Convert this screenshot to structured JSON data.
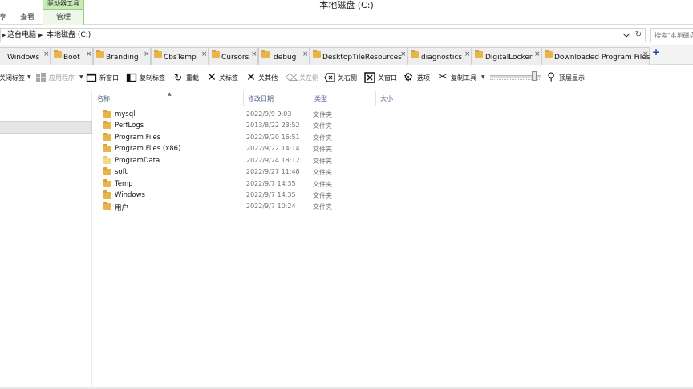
{
  "window": {
    "title": "本地磁盘 (C:)"
  },
  "ribbon": {
    "context_group": "驱动器工具",
    "tabs": [
      {
        "label": "享"
      },
      {
        "label": "查看"
      },
      {
        "label": "管理"
      }
    ]
  },
  "address": {
    "crumbs": [
      "这台电脑",
      "本地磁盘 (C:)"
    ],
    "search_placeholder": "搜索\"本地磁盘"
  },
  "folder_tabs": [
    {
      "label": "Windows"
    },
    {
      "label": "Boot"
    },
    {
      "label": "Branding"
    },
    {
      "label": "CbsTemp"
    },
    {
      "label": "Cursors"
    },
    {
      "label": "debug"
    },
    {
      "label": "DesktopTileResources"
    },
    {
      "label": "diagnostics"
    },
    {
      "label": "DigitalLocker"
    },
    {
      "label": "Downloaded Program Files"
    }
  ],
  "new_tab_symbol": "+",
  "close_symbol": "×",
  "toolbar": {
    "close_tabs": "关闭标签",
    "apps": "应用程序",
    "new_window": "新窗口",
    "copy_tab": "复制标签",
    "reload": "重载",
    "close_tab": "关标签",
    "close_others": "关其他",
    "close_left": "关左侧",
    "close_right": "关右侧",
    "close_window": "关窗口",
    "options": "选项",
    "copy_tools": "复制工具",
    "top_most": "顶层显示",
    "opacity_level": 0.9
  },
  "columns": {
    "name": "名称",
    "modified": "修改日期",
    "type": "类型",
    "size": "大小"
  },
  "files": [
    {
      "name": "mysql",
      "modified": "2022/9/9 9:03",
      "type": "文件夹"
    },
    {
      "name": "PerfLogs",
      "modified": "2013/8/22 23:52",
      "type": "文件夹"
    },
    {
      "name": "Program Files",
      "modified": "2022/9/20 16:51",
      "type": "文件夹"
    },
    {
      "name": "Program Files (x86)",
      "modified": "2022/9/22 14:14",
      "type": "文件夹"
    },
    {
      "name": "ProgramData",
      "modified": "2022/9/24 18:12",
      "type": "文件夹"
    },
    {
      "name": "soft",
      "modified": "2022/9/27 11:48",
      "type": "文件夹"
    },
    {
      "name": "Temp",
      "modified": "2022/9/7 14:35",
      "type": "文件夹"
    },
    {
      "name": "Windows",
      "modified": "2022/9/7 14:35",
      "type": "文件夹"
    },
    {
      "name": "用户",
      "modified": "2022/9/7 10:24",
      "type": "文件夹"
    }
  ]
}
